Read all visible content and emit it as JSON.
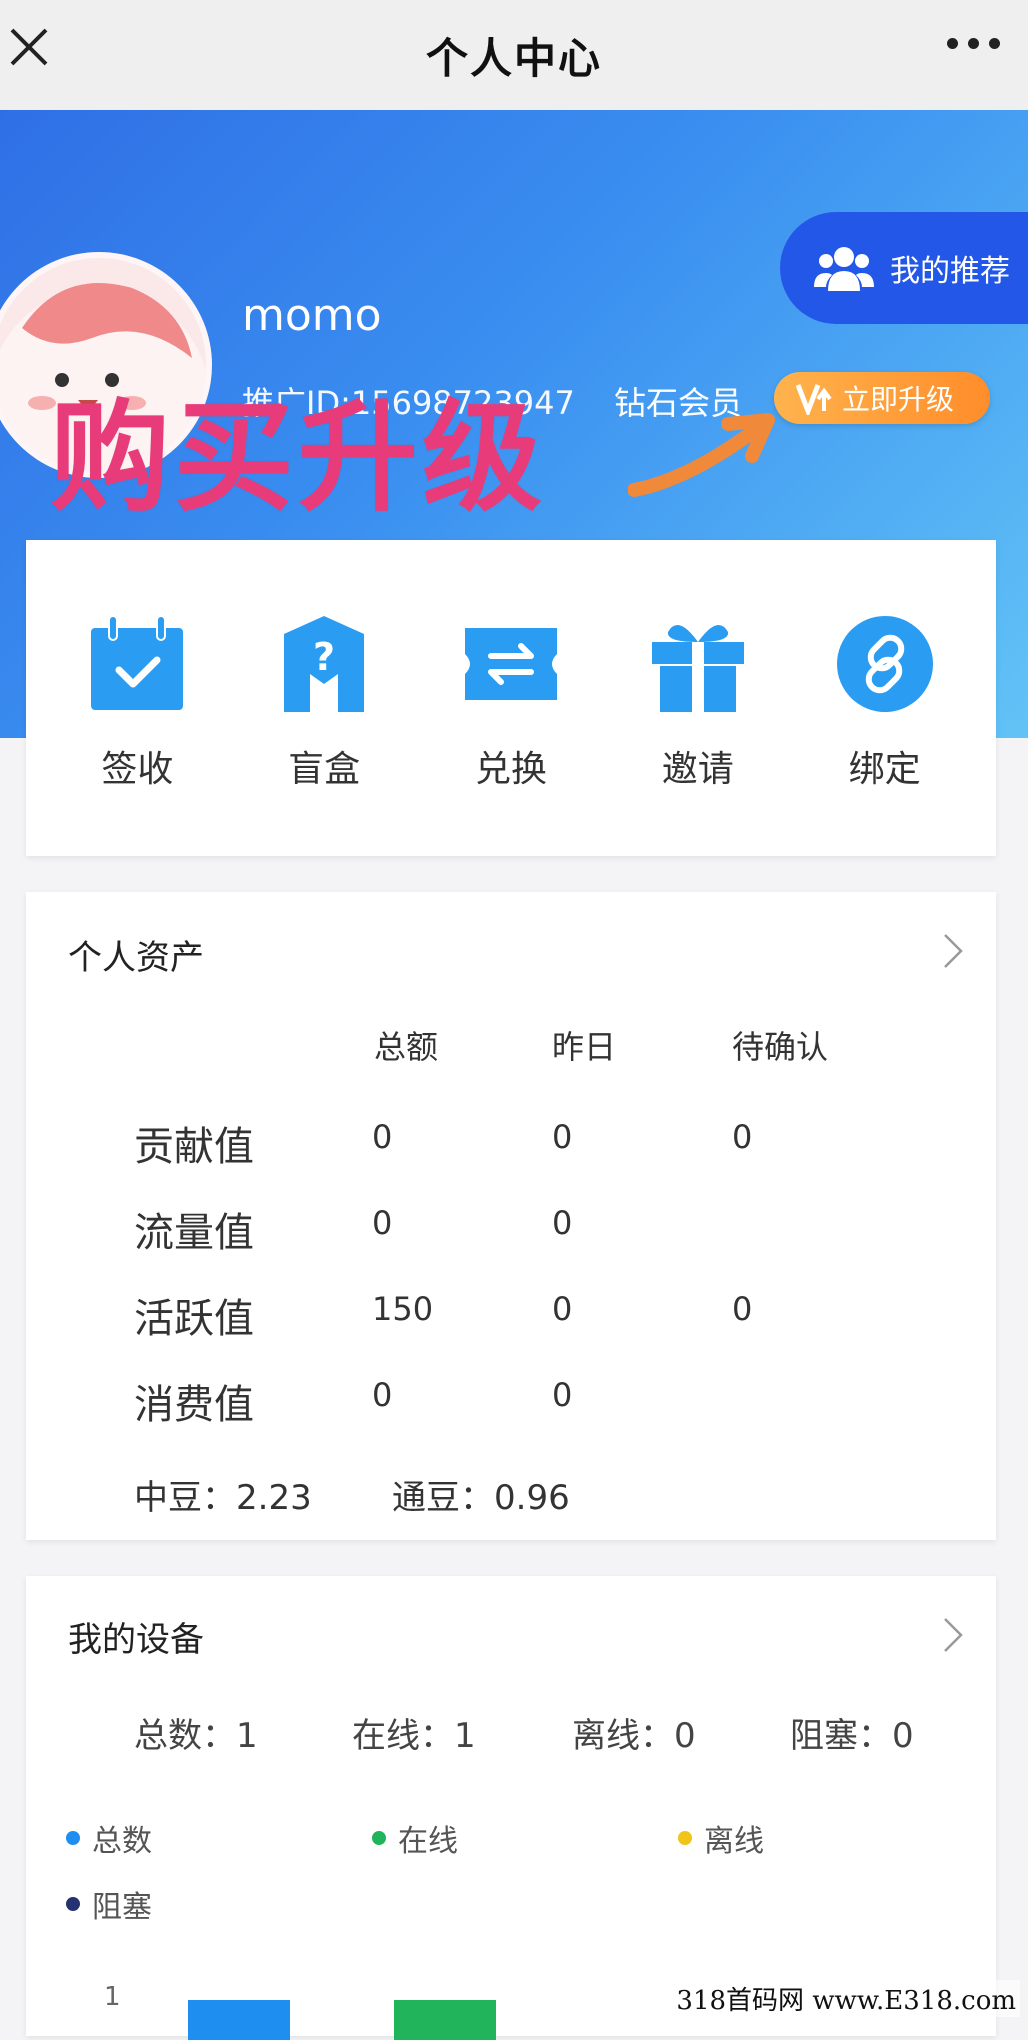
{
  "navbar": {
    "title": "个人中心"
  },
  "profile": {
    "username": "momo",
    "user_id": "推广ID:15698723947",
    "member_level": "钻石会员",
    "upgrade_label": "立即升级",
    "recommend_label": "我的推荐",
    "promo_overlay": "购买升级"
  },
  "actions": [
    {
      "label": "签收",
      "icon": "calendar-check-icon"
    },
    {
      "label": "盲盒",
      "icon": "blind-box-icon"
    },
    {
      "label": "兑换",
      "icon": "exchange-icon"
    },
    {
      "label": "邀请",
      "icon": "gift-icon"
    },
    {
      "label": "绑定",
      "icon": "link-icon"
    }
  ],
  "assets": {
    "title": "个人资产",
    "headers": [
      "总额",
      "昨日",
      "待确认"
    ],
    "rows": [
      {
        "label": "贡献值",
        "total": "0",
        "yesterday": "0",
        "pending": "0"
      },
      {
        "label": "流量值",
        "total": "0",
        "yesterday": "0",
        "pending": ""
      },
      {
        "label": "活跃值",
        "total": "150",
        "yesterday": "0",
        "pending": "0"
      },
      {
        "label": "消费值",
        "total": "0",
        "yesterday": "0",
        "pending": ""
      }
    ],
    "zhongdou": "中豆：2.23",
    "tongdou": "通豆：0.96"
  },
  "devices": {
    "title": "我的设备",
    "stats": [
      "总数：1",
      "在线：1",
      "离线：0",
      "阻塞：0"
    ],
    "legend": [
      {
        "name": "总数",
        "color": "#1e8ef0"
      },
      {
        "name": "在线",
        "color": "#22b45a"
      },
      {
        "name": "离线",
        "color": "#f2c318"
      },
      {
        "name": "阻塞",
        "color": "#253272"
      }
    ],
    "chart_data": {
      "type": "bar",
      "categories": [
        "总数",
        "在线"
      ],
      "values": [
        1,
        1
      ],
      "y_ticks": [
        "1"
      ]
    }
  },
  "watermark": "318首码网 www.E318.com",
  "colors": {
    "header_start": "#2f6fe6",
    "header_end": "#62c3f6",
    "accent": "#2357e8",
    "upgrade": "#ff9a33",
    "promo": "#e83c7a"
  }
}
